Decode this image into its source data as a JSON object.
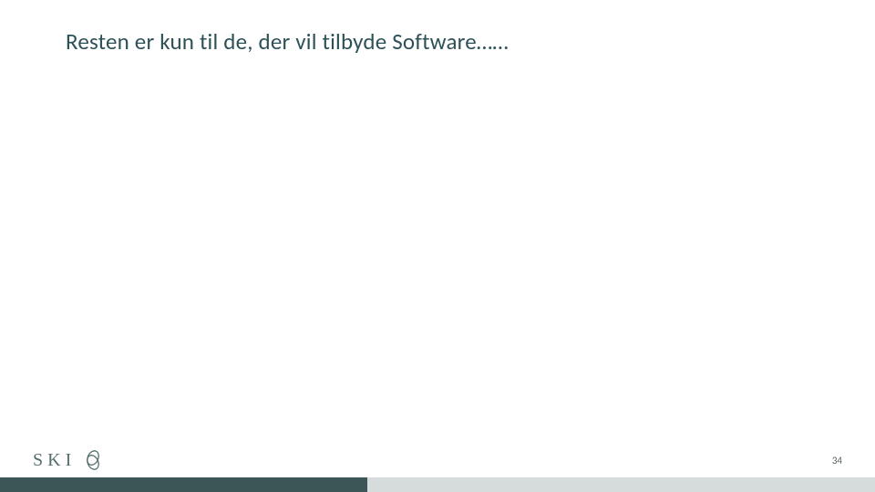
{
  "slide": {
    "title": "Resten er kun til de, der vil tilbyde Software……"
  },
  "footer": {
    "brand_text": "SKI",
    "page_number": "34"
  },
  "colors": {
    "title": "#2e5158",
    "brand": "#566e6f",
    "bar_dark": "#3c5557",
    "bar_light": "#d6dbdb"
  }
}
